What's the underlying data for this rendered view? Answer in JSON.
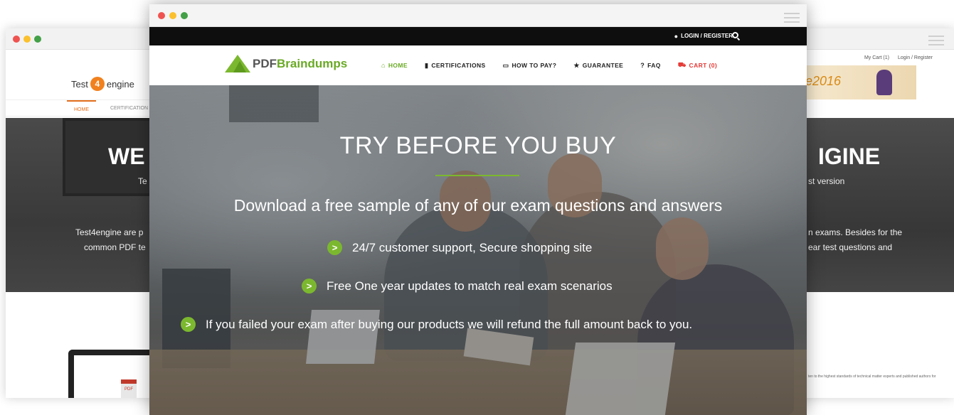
{
  "left_window": {
    "logo_pre": "Test",
    "logo_num": "4",
    "logo_post": "engine",
    "nav_home": "HOME",
    "nav_cert": "CERTIFICATION",
    "hero_title": "WE",
    "hero_sub": "Te",
    "para1": "Test4engine are p",
    "para2": "common PDF te",
    "monitor_pdf": "PDF"
  },
  "right_window": {
    "top_links": [
      "My Cart (1)",
      "Login / Register"
    ],
    "banner_text": "e2016",
    "hero_title": "IGINE",
    "hero_sub": "st version",
    "para1": "n exams. Besides for the",
    "para2": "ear test questions and",
    "small_text": "ten to the highest standards of technical matter experts and published authors for"
  },
  "main_window": {
    "topbar": {
      "login_label": "LOGIN / REGISTER"
    },
    "brand": {
      "pdf": "PDF",
      "braindumps": "Braindumps"
    },
    "nav": [
      {
        "label": "HOME",
        "icon": "home-icon",
        "glyph": "⌂"
      },
      {
        "label": "CERTIFICATIONS",
        "icon": "book-icon",
        "glyph": "▮"
      },
      {
        "label": "HOW TO PAY?",
        "icon": "card-icon",
        "glyph": "▭"
      },
      {
        "label": "GUARANTEE",
        "icon": "star-icon",
        "glyph": "★"
      },
      {
        "label": "FAQ",
        "icon": "question-icon",
        "glyph": "?"
      },
      {
        "label": "CART (0)",
        "icon": "cart-icon",
        "glyph": "⛟"
      }
    ],
    "hero": {
      "title": "TRY BEFORE YOU BUY",
      "subtitle": "Download a free sample of any of our exam questions and answers",
      "bullets": [
        "24/7 customer support, Secure shopping site",
        "Free One year updates to match real exam scenarios",
        "If you failed your exam after buying our products we will refund the full amount back to you."
      ]
    }
  },
  "colors": {
    "accent_green": "#7cb82f",
    "cart_red": "#e53935",
    "topbar_black": "#0e0e0e",
    "test4engine_orange": "#f0811e"
  }
}
